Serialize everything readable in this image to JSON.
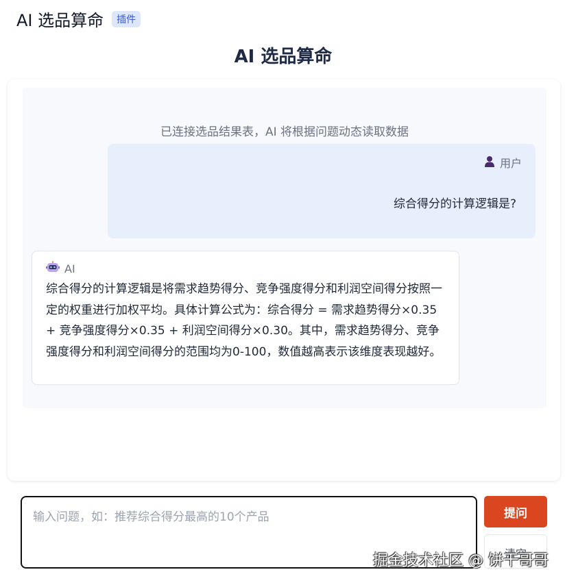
{
  "header": {
    "title": "AI 选品算命",
    "badge": "插件"
  },
  "page_title": "AI 选品算命",
  "chat": {
    "system_note": "已连接选品结果表，AI 将根据问题动态读取数据",
    "messages": [
      {
        "role_label": "用户",
        "icon": "user-icon",
        "text": "综合得分的计算逻辑是?"
      },
      {
        "role_label": "AI",
        "icon": "robot-icon",
        "text": "综合得分的计算逻辑是将需求趋势得分、竞争强度得分和利润空间得分按照一定的权重进行加权平均。具体计算公式为：综合得分 = 需求趋势得分×0.35 + 竞争强度得分×0.35 + 利润空间得分×0.30。其中，需求趋势得分、竞争强度得分和利润空间得分的范围均为0-100，数值越高表示该维度表现越好。"
      }
    ]
  },
  "input": {
    "placeholder": "输入问题，如：推荐综合得分最高的10个产品",
    "value": ""
  },
  "buttons": {
    "ask": "提问",
    "clear": "清空"
  },
  "watermark": "掘金技术社区 @ 饼干哥哥",
  "colors": {
    "accent": "#d9461f",
    "user_bubble": "#e7effd",
    "badge_bg": "#dde6fb"
  }
}
